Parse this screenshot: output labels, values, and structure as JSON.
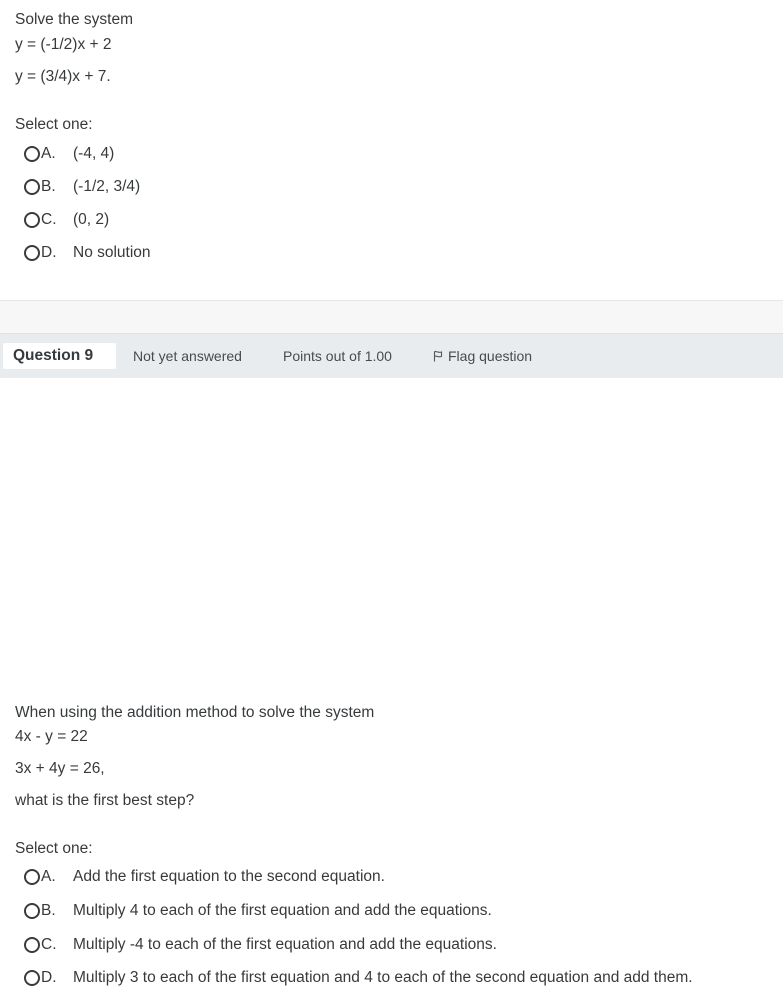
{
  "q8": {
    "prompt": "Solve the system",
    "eq1": "y = (-1/2)x + 2",
    "eq2": "y = (3/4)x + 7.",
    "select_label": "Select one:",
    "options": [
      {
        "letter": "A.",
        "text": "(-4, 4)"
      },
      {
        "letter": "B.",
        "text": "(-1/2, 3/4)"
      },
      {
        "letter": "C.",
        "text": "(0, 2)"
      },
      {
        "letter": "D.",
        "text": "No solution"
      }
    ]
  },
  "q9": {
    "info": {
      "question_label": "Question 9",
      "status": "Not yet answered",
      "points": "Points out of 1.00",
      "flag_label": "Flag question"
    },
    "prompt": "When using the addition method to solve the system",
    "eq1": "4x - y = 22",
    "eq2": "3x + 4y = 26,",
    "question": "what is the first best step?",
    "select_label": "Select one:",
    "options": [
      {
        "letter": "A.",
        "text": "Add the first equation to the second equation."
      },
      {
        "letter": "B.",
        "text": "Multiply 4 to each of the first equation and add the equations."
      },
      {
        "letter": "C.",
        "text": "Multiply -4 to each of the first equation and add the equations."
      },
      {
        "letter": "D.",
        "text": "Multiply 3 to each of the first equation and 4 to each of the second equation and add them."
      }
    ]
  },
  "icons": {
    "flag": "flag-icon",
    "radio": "radio-unchecked-icon"
  }
}
